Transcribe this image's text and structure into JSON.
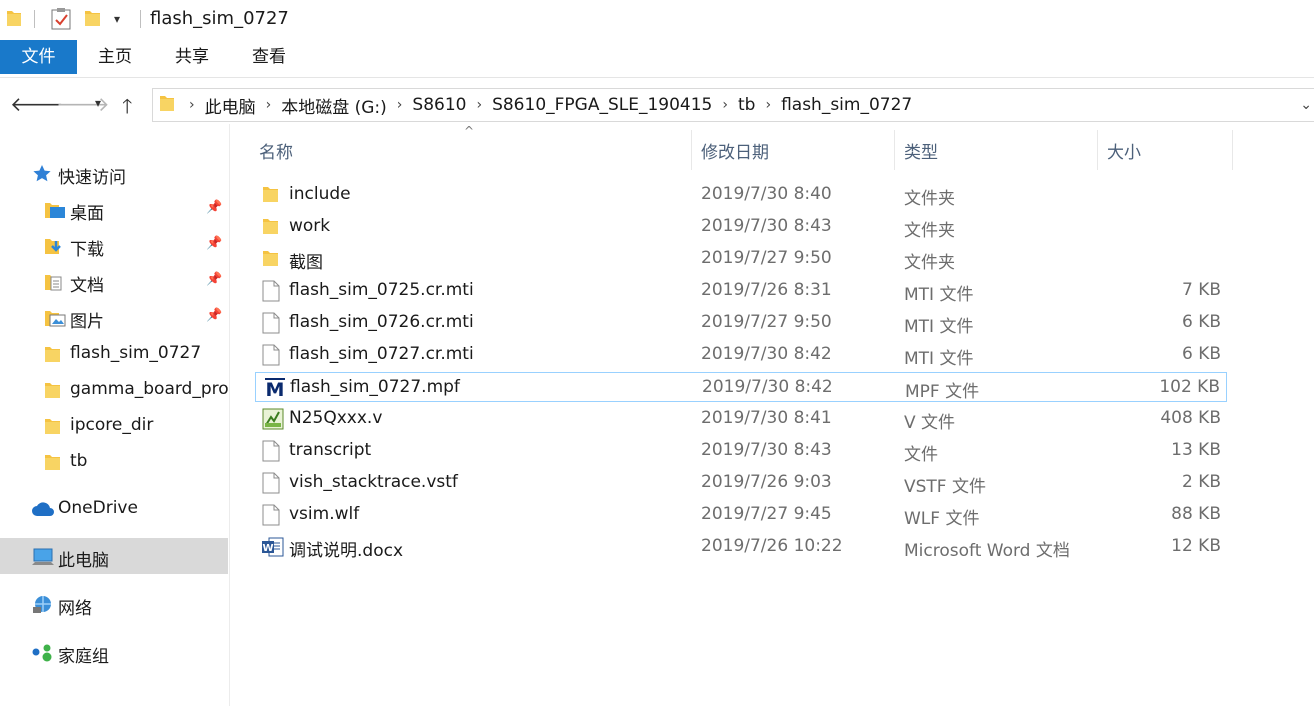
{
  "window": {
    "title": "flash_sim_0727"
  },
  "ribbon": {
    "tabs": [
      {
        "label": "文件"
      },
      {
        "label": "主页"
      },
      {
        "label": "共享"
      },
      {
        "label": "查看"
      }
    ]
  },
  "address": {
    "crumbs": [
      "此电脑",
      "本地磁盘 (G:)",
      "S8610",
      "S8610_FPGA_SLE_190415",
      "tb",
      "flash_sim_0727"
    ]
  },
  "sidebar": {
    "quick_access": "快速访问",
    "items": [
      {
        "label": "桌面",
        "pinned": true
      },
      {
        "label": "下载",
        "pinned": true
      },
      {
        "label": "文档",
        "pinned": true
      },
      {
        "label": "图片",
        "pinned": true
      },
      {
        "label": "flash_sim_0727"
      },
      {
        "label": "gamma_board_pro"
      },
      {
        "label": "ipcore_dir"
      },
      {
        "label": "tb"
      }
    ],
    "onedrive": "OneDrive",
    "this_pc": "此电脑",
    "network": "网络",
    "homegroup": "家庭组"
  },
  "columns": {
    "name": "名称",
    "date": "修改日期",
    "type": "类型",
    "size": "大小"
  },
  "files": [
    {
      "name": "include",
      "date": "2019/7/30 8:40",
      "type": "文件夹",
      "size": "",
      "icon": "folder-icon"
    },
    {
      "name": "work",
      "date": "2019/7/30 8:43",
      "type": "文件夹",
      "size": "",
      "icon": "folder-icon"
    },
    {
      "name": "截图",
      "date": "2019/7/27 9:50",
      "type": "文件夹",
      "size": "",
      "icon": "folder-icon"
    },
    {
      "name": "flash_sim_0725.cr.mti",
      "date": "2019/7/26 8:31",
      "type": "MTI 文件",
      "size": "7 KB",
      "icon": "file-icon"
    },
    {
      "name": "flash_sim_0726.cr.mti",
      "date": "2019/7/27 9:50",
      "type": "MTI 文件",
      "size": "6 KB",
      "icon": "file-icon"
    },
    {
      "name": "flash_sim_0727.cr.mti",
      "date": "2019/7/30 8:42",
      "type": "MTI 文件",
      "size": "6 KB",
      "icon": "file-icon"
    },
    {
      "name": "flash_sim_0727.mpf",
      "date": "2019/7/30 8:42",
      "type": "MPF 文件",
      "size": "102 KB",
      "icon": "modelsim-icon"
    },
    {
      "name": "N25Qxxx.v",
      "date": "2019/7/30 8:41",
      "type": "V 文件",
      "size": "408 KB",
      "icon": "verilog-file-icon"
    },
    {
      "name": "transcript",
      "date": "2019/7/30 8:43",
      "type": "文件",
      "size": "13 KB",
      "icon": "file-icon"
    },
    {
      "name": "vish_stacktrace.vstf",
      "date": "2019/7/26 9:03",
      "type": "VSTF 文件",
      "size": "2 KB",
      "icon": "file-icon"
    },
    {
      "name": "vsim.wlf",
      "date": "2019/7/27 9:45",
      "type": "WLF 文件",
      "size": "88 KB",
      "icon": "file-icon"
    },
    {
      "name": "调试说明.docx",
      "date": "2019/7/26 10:22",
      "type": "Microsoft Word 文档",
      "size": "12 KB",
      "icon": "word-doc-icon"
    }
  ],
  "colors": {
    "accent": "#1979ca",
    "folder": "#f5c342",
    "selected_bg": "#d9d9d9",
    "hover_border": "#99d1ff"
  }
}
